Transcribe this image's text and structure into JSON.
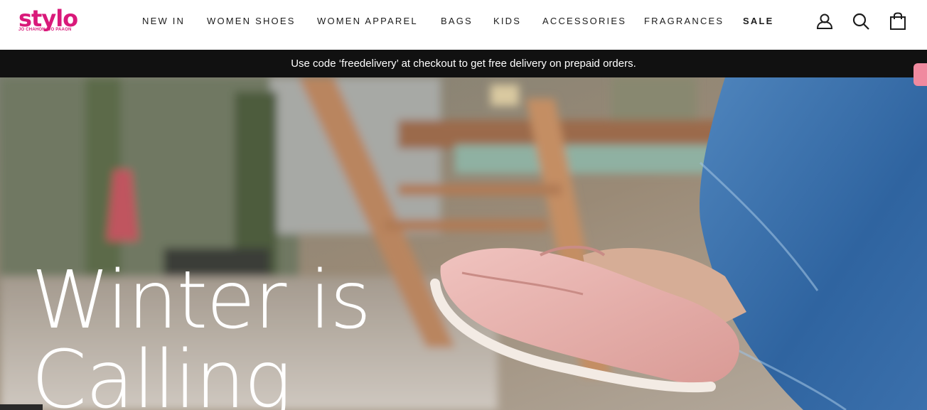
{
  "brand": {
    "name": "stylo",
    "tagline": "JO CHAHON   WO PAAON",
    "accent_color": "#d9197a"
  },
  "nav": {
    "items": [
      {
        "label": "NEW IN"
      },
      {
        "label": "WOMEN SHOES"
      },
      {
        "label": "WOMEN APPAREL"
      },
      {
        "label": "BAGS"
      },
      {
        "label": "KIDS"
      },
      {
        "label": "ACCESSORIES"
      },
      {
        "label": "FRAGRANCES"
      },
      {
        "label": "SALE"
      }
    ]
  },
  "header_icons": [
    "account-icon",
    "search-icon",
    "cart-icon"
  ],
  "promo": {
    "text": "Use code ‘freedelivery’ at checkout to get free delivery on prepaid orders."
  },
  "hero": {
    "title": "Winter is\nCalling"
  }
}
